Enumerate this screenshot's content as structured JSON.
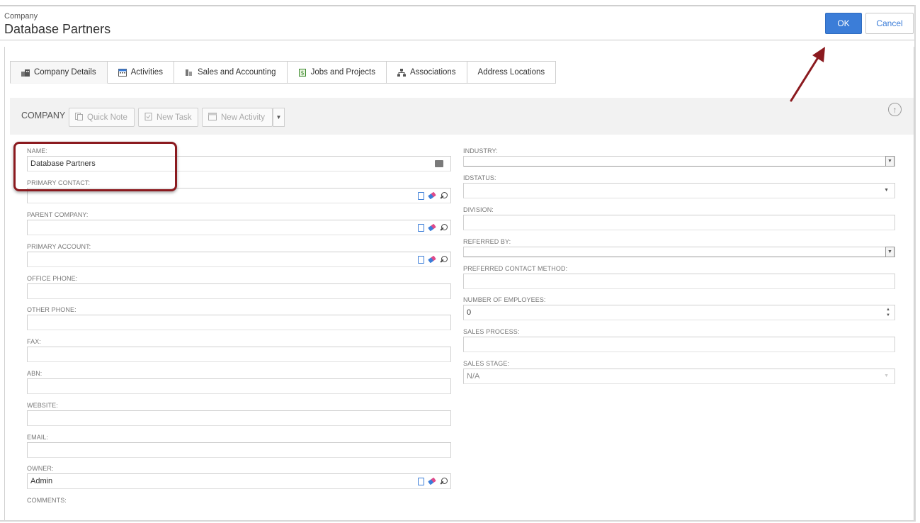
{
  "header": {
    "entity_type": "Company",
    "entity_name": "Database Partners",
    "ok_label": "OK",
    "cancel_label": "Cancel"
  },
  "tabs": [
    {
      "label": "Company Details",
      "icon": "company-icon",
      "active": true
    },
    {
      "label": "Activities",
      "icon": "calendar-icon",
      "active": false
    },
    {
      "label": "Sales and Accounting",
      "icon": "coins-icon",
      "active": false
    },
    {
      "label": "Jobs and Projects",
      "icon": "dollar-doc-icon",
      "active": false
    },
    {
      "label": "Associations",
      "icon": "hierarchy-icon",
      "active": false
    },
    {
      "label": "Address Locations",
      "icon": "",
      "active": false
    }
  ],
  "toolbar": {
    "title": "COMPANY",
    "quick_note_label": "Quick Note",
    "new_task_label": "New Task",
    "new_activity_label": "New Activity"
  },
  "left_fields": {
    "name": {
      "label": "NAME:",
      "value": "Database Partners"
    },
    "primary_contact": {
      "label": "PRIMARY CONTACT:",
      "value": ""
    },
    "parent_company": {
      "label": "PARENT COMPANY:",
      "value": ""
    },
    "primary_account": {
      "label": "PRIMARY ACCOUNT:",
      "value": ""
    },
    "office_phone": {
      "label": "OFFICE PHONE:",
      "value": ""
    },
    "other_phone": {
      "label": "OTHER PHONE:",
      "value": ""
    },
    "fax": {
      "label": "FAX:",
      "value": ""
    },
    "abn": {
      "label": "ABN:",
      "value": ""
    },
    "website": {
      "label": "WEBSITE:",
      "value": ""
    },
    "email": {
      "label": "EMAIL:",
      "value": ""
    },
    "owner": {
      "label": "OWNER:",
      "value": "Admin"
    },
    "comments": {
      "label": "COMMENTS:",
      "value": ""
    }
  },
  "right_fields": {
    "industry": {
      "label": "INDUSTRY:",
      "value": ""
    },
    "idstatus": {
      "label": "IDSTATUS:",
      "value": ""
    },
    "division": {
      "label": "DIVISION:",
      "value": ""
    },
    "referred_by": {
      "label": "REFERRED BY:",
      "value": ""
    },
    "preferred_contact_method": {
      "label": "PREFERRED CONTACT METHOD:",
      "value": ""
    },
    "number_of_employees": {
      "label": "NUMBER OF EMPLOYEES:",
      "value": "0"
    },
    "sales_process": {
      "label": "SALES PROCESS:",
      "value": ""
    },
    "sales_stage": {
      "label": "SALES STAGE:",
      "value": "N/A"
    }
  },
  "colors": {
    "accent": "#3b7dd8",
    "annotation": "#8b1a1f"
  }
}
